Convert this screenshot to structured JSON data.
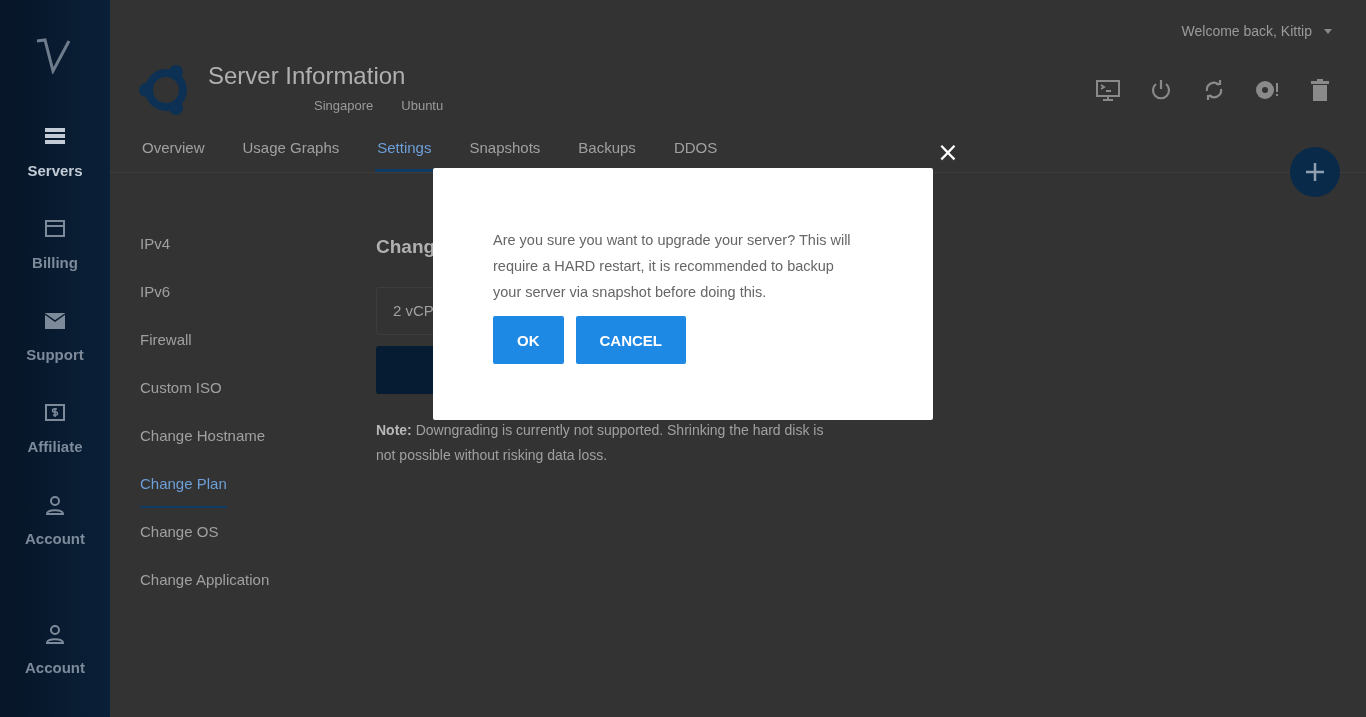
{
  "sidebar": {
    "items": [
      {
        "label": "Servers",
        "selected": true
      },
      {
        "label": "Billing",
        "selected": false
      },
      {
        "label": "Support",
        "selected": false
      },
      {
        "label": "Affiliate",
        "selected": false
      },
      {
        "label": "Account",
        "selected": false
      }
    ],
    "bottom_item": {
      "label": "Account",
      "selected": false
    }
  },
  "user_menu": {
    "greeting": "Welcome back, Kittip"
  },
  "server": {
    "title": "Server Information",
    "location": "Singapore",
    "os": "Ubuntu"
  },
  "tabs": [
    {
      "label": "Overview",
      "selected": false
    },
    {
      "label": "Usage Graphs",
      "selected": false
    },
    {
      "label": "Settings",
      "selected": true
    },
    {
      "label": "Snapshots",
      "selected": false
    },
    {
      "label": "Backups",
      "selected": false
    },
    {
      "label": "DDOS",
      "selected": false
    }
  ],
  "settings_menu": [
    {
      "label": "IPv4",
      "selected": false
    },
    {
      "label": "IPv6",
      "selected": false
    },
    {
      "label": "Firewall",
      "selected": false
    },
    {
      "label": "Custom ISO",
      "selected": false
    },
    {
      "label": "Change Hostname",
      "selected": false
    },
    {
      "label": "Change Plan",
      "selected": true
    },
    {
      "label": "Change OS",
      "selected": false
    },
    {
      "label": "Change Application",
      "selected": false
    }
  ],
  "panel": {
    "heading": "Chang",
    "plan_select": "2 vCP",
    "note": "**Note:** Downgrading is currently not supported. Shrinking the hard disk is not possible without risking data loss."
  },
  "dialog": {
    "close": "×",
    "message": "Are you sure you want to upgrade your server? This will require a HARD restart, it is recommended to backup your server via snapshot before doing this.",
    "buttons": [
      "OK",
      "CANCEL"
    ]
  }
}
